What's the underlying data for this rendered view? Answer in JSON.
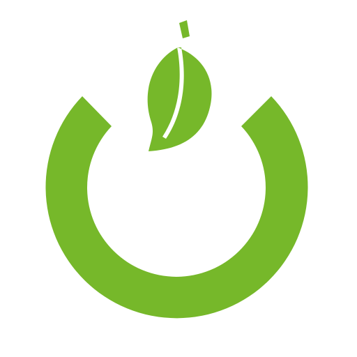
{
  "logo": {
    "icon": "leaf-power-icon",
    "colors": {
      "primary": "#76b82a",
      "background": "#ffffff"
    }
  }
}
